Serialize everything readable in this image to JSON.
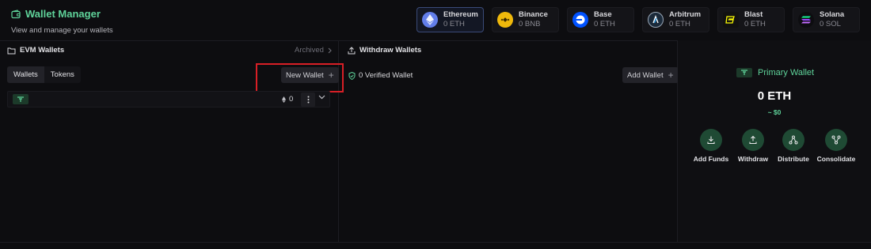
{
  "header": {
    "title": "Wallet Manager",
    "subtitle": "View and manage your wallets"
  },
  "chains": [
    {
      "name": "Ethereum",
      "balance": "0 ETH",
      "icon": "ethereum-logo",
      "color": "#627eea",
      "active": true
    },
    {
      "name": "Binance",
      "balance": "0 BNB",
      "icon": "binance-logo",
      "color": "#f0b90b",
      "active": false
    },
    {
      "name": "Base",
      "balance": "0 ETH",
      "icon": "base-logo",
      "color": "#0052ff",
      "active": false
    },
    {
      "name": "Arbitrum",
      "balance": "0 ETH",
      "icon": "arbitrum-logo",
      "color": "#1b2a3a",
      "active": false
    },
    {
      "name": "Blast",
      "balance": "0 ETH",
      "icon": "blast-logo",
      "color": "#fcfc03",
      "active": false
    },
    {
      "name": "Solana",
      "balance": "0 SOL",
      "icon": "solana-logo",
      "color": "#9945ff",
      "active": false
    }
  ],
  "evm_panel": {
    "title": "EVM Wallets",
    "archived_label": "Archived",
    "tabs": [
      {
        "label": "Wallets",
        "active": true
      },
      {
        "label": "Tokens",
        "active": false
      }
    ],
    "new_wallet_label": "New Wallet",
    "wallet_row": {
      "count": "0"
    }
  },
  "withdraw_panel": {
    "title": "Withdraw Wallets",
    "verified_label": "0 Verified Wallet",
    "add_wallet_label": "Add Wallet"
  },
  "primary_wallet": {
    "title": "Primary Wallet",
    "amount": "0 ETH",
    "usd": "~ $0",
    "actions": [
      {
        "label": "Add Funds",
        "icon": "download-icon"
      },
      {
        "label": "Withdraw",
        "icon": "upload-icon"
      },
      {
        "label": "Distribute",
        "icon": "distribute-icon"
      },
      {
        "label": "Consolidate",
        "icon": "consolidate-icon"
      }
    ]
  },
  "colors": {
    "accent": "#5fd39a",
    "background": "#0d0d10",
    "highlight": "#d81f26"
  }
}
